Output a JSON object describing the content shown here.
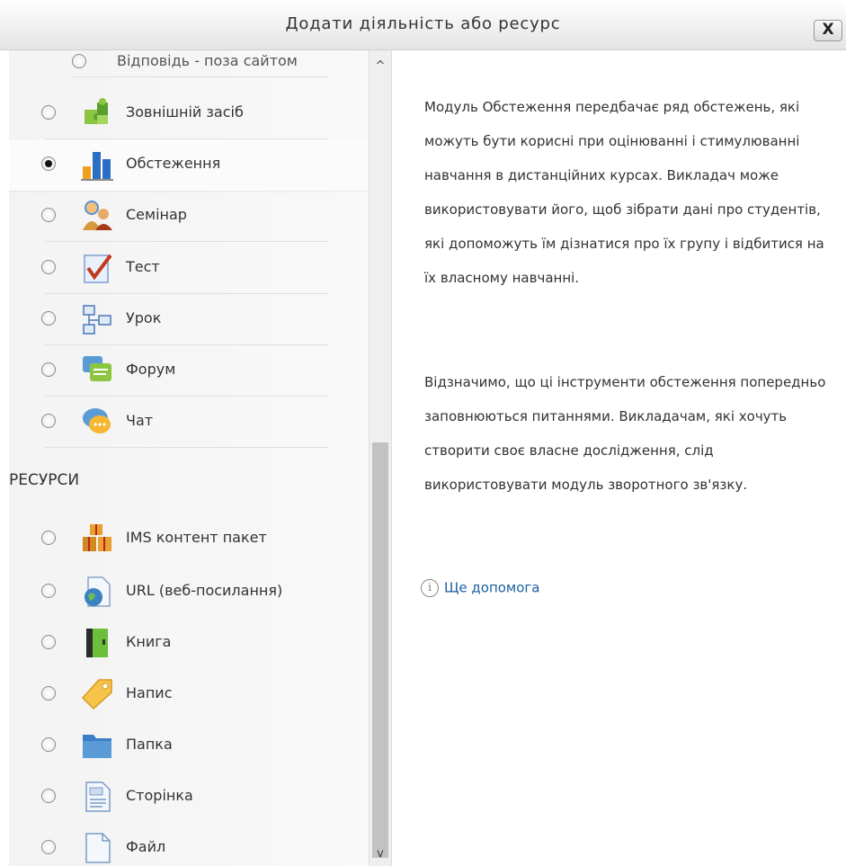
{
  "dialog": {
    "title": "Додати діяльність або ресурс",
    "close_label": "X"
  },
  "activities": [
    {
      "label": "Відповідь - поза сайтом",
      "icon": "external-reply-icon"
    },
    {
      "label": "Зовнішній засіб",
      "icon": "puzzle-icon"
    },
    {
      "label": "Обстеження",
      "icon": "bar-chart-icon",
      "selected": true
    },
    {
      "label": "Семінар",
      "icon": "people-icon"
    },
    {
      "label": "Тест",
      "icon": "checkmark-page-icon"
    },
    {
      "label": "Урок",
      "icon": "flowchart-icon"
    },
    {
      "label": "Форум",
      "icon": "forum-icon"
    },
    {
      "label": "Чат",
      "icon": "chat-bubble-icon"
    }
  ],
  "resources_heading": "РЕСУРСИ",
  "resources": [
    {
      "label": "IMS контент пакет",
      "icon": "boxes-icon"
    },
    {
      "label": "URL (веб-посилання)",
      "icon": "globe-page-icon"
    },
    {
      "label": "Книга",
      "icon": "book-icon"
    },
    {
      "label": "Напис",
      "icon": "tag-icon"
    },
    {
      "label": "Папка",
      "icon": "folder-icon"
    },
    {
      "label": "Сторінка",
      "icon": "page-icon"
    },
    {
      "label": "Файл",
      "icon": "file-icon"
    }
  ],
  "description": {
    "paragraph1": "Модуль Обстеження передбачає ряд обстежень, які можуть бути корисні при оцінюванні і стимулюванні навчання в дистанційних курсах. Викладач може використовувати його, щоб зібрати дані про студентів, які допоможуть їм дізнатися про їх групу і відбитися на їх власному навчанні.",
    "paragraph2": "Відзначимо, що ці інструменти обстеження попередньо заповнюються питаннями. Викладачам, які хочуть створити своє власне дослідження, слід використовувати модуль зворотного зв'язку.",
    "help_link": "Ще допомога",
    "help_icon": "info-circle-icon"
  },
  "scrollbar": {
    "up_arrow": "^",
    "down_arrow": "v"
  },
  "colors": {
    "link": "#1a5fa0",
    "pane_background": "#f3f3f3",
    "scroll_thumb": "#c2c2c2"
  }
}
